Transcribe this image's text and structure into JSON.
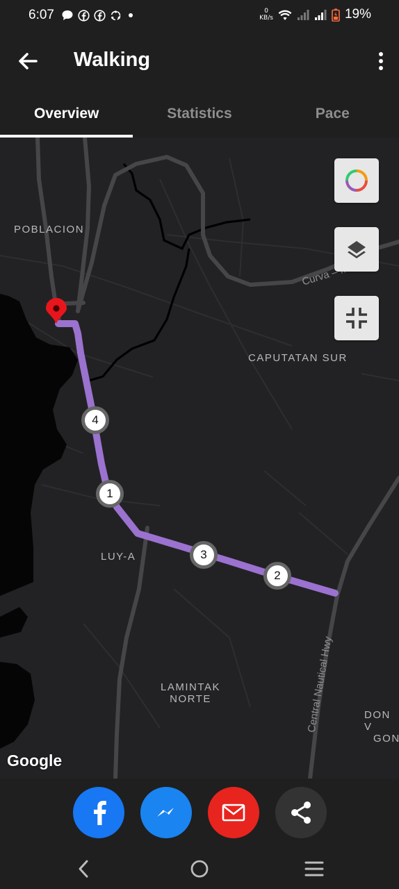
{
  "status_bar": {
    "time": "6:07",
    "notification_icons": [
      "chat-bubble-icon",
      "facebook-icon",
      "facebook-icon",
      "recycle-icon",
      "dot-icon"
    ],
    "net_speed_value": "0",
    "net_speed_unit": "KB/s",
    "battery_percent": "19%"
  },
  "app_bar": {
    "title": "Walking",
    "back_icon": "arrow-left-icon",
    "menu_icon": "more-vertical-icon"
  },
  "tabs": [
    {
      "label": "Overview",
      "active": true
    },
    {
      "label": "Statistics",
      "active": false
    },
    {
      "label": "Pace",
      "active": false
    }
  ],
  "map": {
    "place_labels": {
      "poblacion": "POBLACION",
      "caputatan_sur": "CAPUTATAN SUR",
      "luy_a": "LUY-A",
      "lamintak_norte_1": "LAMINTAK",
      "lamintak_norte_2": "NORTE",
      "don_1": "DON V",
      "don_2": "GON"
    },
    "road_labels": {
      "curva": "Curva – Me",
      "highway": "Central Nautical Hwy"
    },
    "route_color": "#9b72cf",
    "pin_color": "#e8161c",
    "route_markers": [
      "1",
      "2",
      "3",
      "4"
    ],
    "controls": [
      "color-ring-icon",
      "layers-icon",
      "collapse-icon"
    ],
    "attribution": "Google"
  },
  "share_bar": {
    "buttons": [
      {
        "name": "facebook",
        "color": "#1877f2",
        "icon": "facebook-icon"
      },
      {
        "name": "messenger",
        "color": "#1a84f0",
        "icon": "messenger-icon"
      },
      {
        "name": "email",
        "color": "#e8241e",
        "icon": "mail-icon"
      },
      {
        "name": "share",
        "color": "#333333",
        "icon": "share-icon"
      }
    ]
  },
  "nav_bar": {
    "icons": [
      "back-chevron-icon",
      "home-circle-icon",
      "recents-icon"
    ]
  }
}
